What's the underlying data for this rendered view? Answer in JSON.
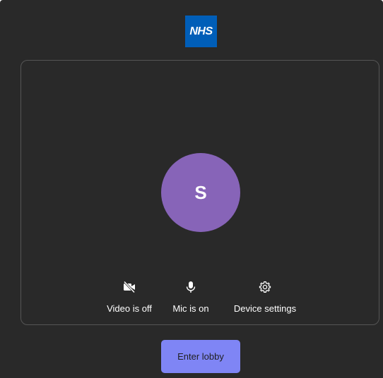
{
  "logo": {
    "text": "NHS",
    "brand_color": "#005eb8"
  },
  "avatar": {
    "initial": "S",
    "color": "#8764b8"
  },
  "controls": {
    "video": {
      "label": "Video is off",
      "icon": "video-off-icon"
    },
    "mic": {
      "label": "Mic is on",
      "icon": "microphone-icon"
    },
    "settings": {
      "label": "Device settings",
      "icon": "gear-icon"
    }
  },
  "enter_button": {
    "label": "Enter lobby",
    "color": "#7f85f5"
  }
}
